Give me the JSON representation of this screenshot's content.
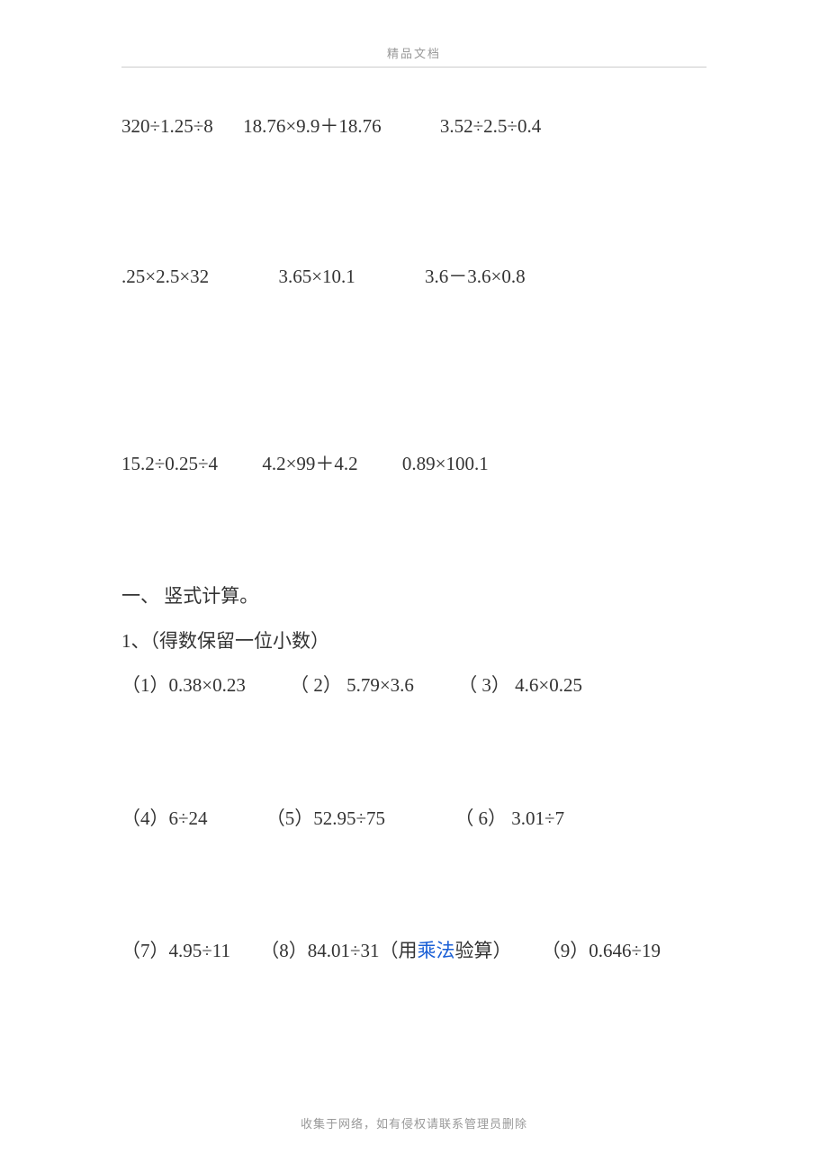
{
  "header": {
    "label": "精品文档"
  },
  "rows_top": [
    {
      "items": [
        "320÷1.25÷8",
        "18.76×9.9＋18.76",
        "3.52÷2.5÷0.4"
      ]
    },
    {
      "items": [
        ".25×2.5×32",
        "3.65×10.1",
        "3.6－3.6×0.8"
      ]
    },
    {
      "items": [
        "15.2÷0.25÷4",
        "4.2×99＋4.2",
        "0.89×100.1"
      ]
    }
  ],
  "section": {
    "title": "一、 竖式计算。",
    "sub1_label": "1、（得数保留一位小数）",
    "probs": [
      {
        "items": [
          "（1）0.38×0.23",
          "（ 2） 5.79×3.6",
          "（ 3） 4.6×0.25"
        ]
      },
      {
        "items": [
          "（4）6÷24",
          "（5）52.95÷75",
          "（ 6） 3.01÷7"
        ]
      }
    ],
    "line3": {
      "p7": "（7）4.95÷11",
      "p8_prefix": "（8）84.01÷31（用",
      "p8_link": "乘法",
      "p8_suffix": "验算）",
      "p9": "（9）0.646÷19"
    }
  },
  "footer": {
    "note": "收集于网络，如有侵权请联系管理员删除"
  }
}
